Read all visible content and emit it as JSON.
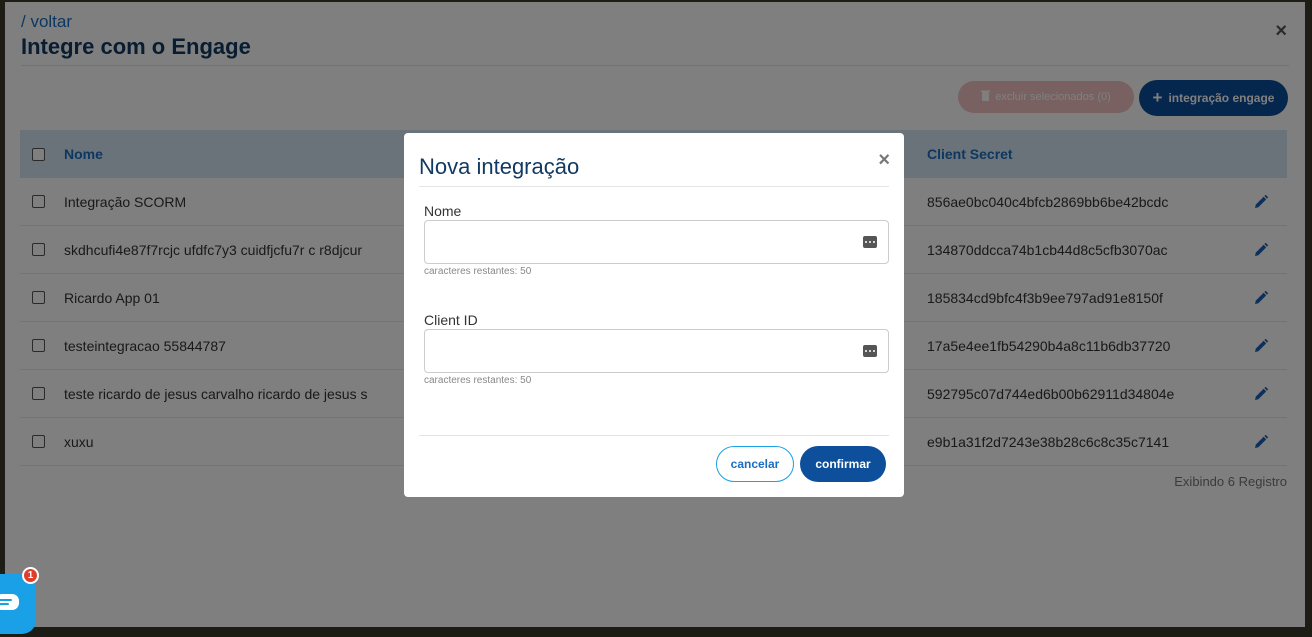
{
  "header": {
    "back_link": "/ voltar",
    "title": "Integre com o Engage",
    "close_label": "×"
  },
  "toolbar": {
    "delete_label": "excluir selecionados (0)",
    "add_label": "integração engage",
    "add_icon": "plus-icon"
  },
  "table": {
    "columns": [
      "Nome",
      "Client Secret"
    ],
    "rows": [
      {
        "name": "Integração SCORM",
        "secret": "856ae0bc040c4bfcb2869bb6be42bcdc"
      },
      {
        "name": "skdhcufi4e87f7rcjc ufdfc7y3 cuidfjcfu7r c r8djcur",
        "secret": "134870ddcca74b1cb44d8c5cfb3070ac"
      },
      {
        "name": "Ricardo App 01",
        "secret": "185834cd9bfc4f3b9ee797ad91e8150f"
      },
      {
        "name": "testeintegracao 55844787",
        "secret": "17a5e4ee1fb54290b4a8c11b6db37720"
      },
      {
        "name": "teste ricardo de jesus carvalho ricardo de jesus s",
        "secret": "592795c07d744ed6b00b62911d34804e"
      },
      {
        "name": "xuxu",
        "secret": "e9b1a31f2d7243e38b28c6c8c35c7141"
      }
    ],
    "footer": "Exibindo 6 Registro"
  },
  "chat": {
    "badge_count": "1",
    "icon": "chat-icon"
  },
  "modal": {
    "title": "Nova integração",
    "close_label": "×",
    "fields": [
      {
        "label": "Nome",
        "value": "",
        "hint": "caracteres restantes: 50"
      },
      {
        "label": "Client ID",
        "value": "",
        "hint": "caracteres restantes: 50"
      }
    ],
    "cancel_label": "cancelar",
    "confirm_label": "confirmar"
  },
  "colors": {
    "primary": "#0d4f9a",
    "accent": "#1aa0e6",
    "title": "#123a63",
    "danger_disabled": "#f3c2c2"
  }
}
